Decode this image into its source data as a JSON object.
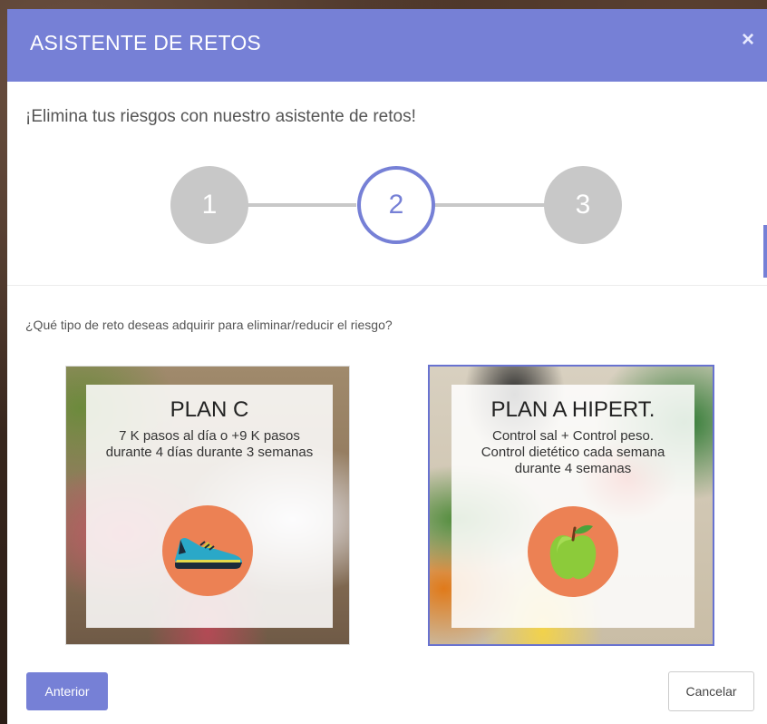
{
  "modal": {
    "title": "ASISTENTE DE RETOS",
    "close_symbol": "×",
    "subtitle": "¡Elimina tus riesgos con nuestro asistente de retos!"
  },
  "stepper": {
    "steps": [
      {
        "label": "1",
        "state": "inactive"
      },
      {
        "label": "2",
        "state": "active"
      },
      {
        "label": "3",
        "state": "inactive"
      }
    ],
    "current_step": 2
  },
  "question": "¿Qué tipo de reto deseas adquirir para eliminar/reducir el riesgo?",
  "cards": [
    {
      "title": "PLAN C",
      "description": "7 K pasos al día o +9 K pasos durante 4 días durante 3 semanas",
      "icon": "running-shoe-icon",
      "selected": false
    },
    {
      "title": "PLAN A HIPERT.",
      "description": "Control sal + Control peso. Control dietético cada semana durante 4 semanas",
      "icon": "apple-icon",
      "selected": true
    }
  ],
  "footer": {
    "prev_label": "Anterior",
    "cancel_label": "Cancelar"
  },
  "colors": {
    "accent": "#7680d6",
    "step_inactive": "#c8c8c8",
    "icon_circle": "#ec8154"
  }
}
